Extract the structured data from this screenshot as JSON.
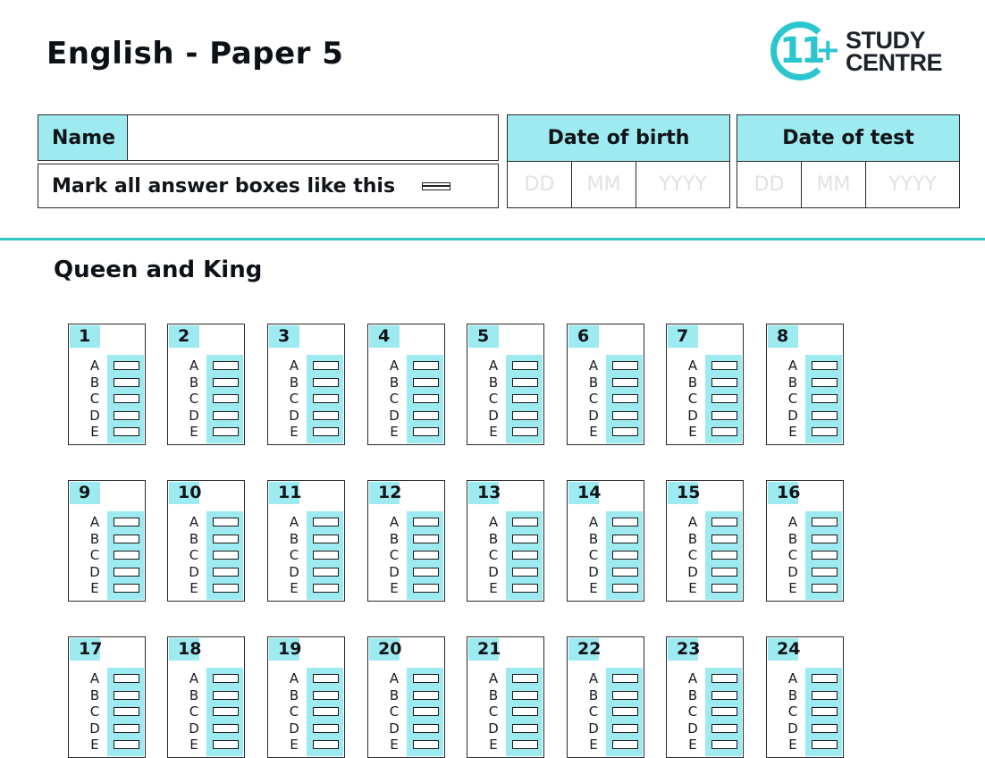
{
  "header": {
    "title": "English - Paper 5",
    "logo": {
      "mark": "11+",
      "line1": "STUDY",
      "line2": "CENTRE",
      "colors": {
        "accent": "#2bc6cf",
        "text": "#1e222a"
      }
    }
  },
  "form": {
    "name_label": "Name",
    "name_value": "",
    "mark_instruction": "Mark all answer boxes like this",
    "date_of_birth": {
      "label": "Date of birth",
      "fields": [
        {
          "placeholder": "DD",
          "value": ""
        },
        {
          "placeholder": "MM",
          "value": ""
        },
        {
          "placeholder": "YYYY",
          "value": ""
        }
      ]
    },
    "date_of_test": {
      "label": "Date of test",
      "fields": [
        {
          "placeholder": "DD",
          "value": ""
        },
        {
          "placeholder": "MM",
          "value": ""
        },
        {
          "placeholder": "YYYY",
          "value": ""
        }
      ]
    }
  },
  "colors": {
    "highlight": "#9debf0",
    "divider": "#2dc9c0"
  },
  "section": {
    "title": "Queen and King",
    "options": [
      "A",
      "B",
      "C",
      "D",
      "E"
    ],
    "questions": [
      "1",
      "2",
      "3",
      "4",
      "5",
      "6",
      "7",
      "8",
      "9",
      "10",
      "11",
      "12",
      "13",
      "14",
      "15",
      "16",
      "17",
      "18",
      "19",
      "20",
      "21",
      "22",
      "23",
      "24"
    ]
  }
}
